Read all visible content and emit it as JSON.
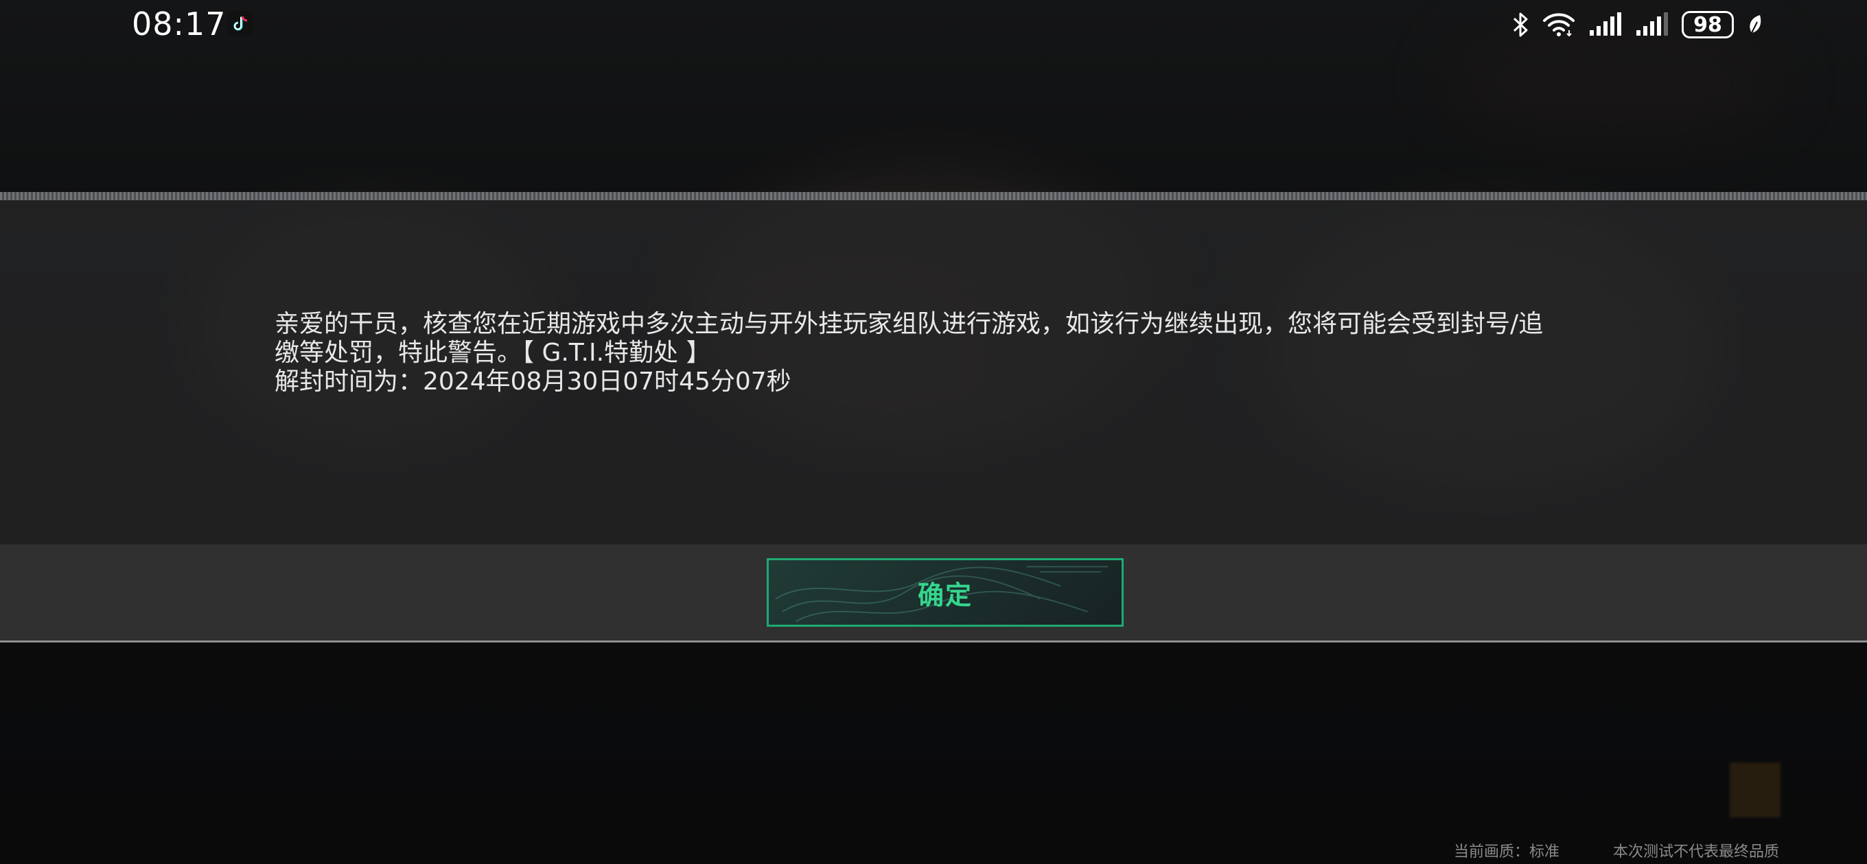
{
  "status_bar": {
    "time": "08:17",
    "battery_level": "98",
    "icons": [
      "tiktok-icon",
      "bluetooth-icon",
      "wifi-icon",
      "signal-icon",
      "signal-icon",
      "battery-icon",
      "leaf-icon"
    ]
  },
  "dialog": {
    "message": "亲爱的干员，核查您在近期游戏中多次主动与开外挂玩家组队进行游戏，如该行为继续出现，您将可能会受到封号/追\n缴等处罚，特此警告。【 G.T.I.特勤处 】\n解封时间为：2024年08月30日07时45分07秒",
    "confirm_label": "确定"
  },
  "footer": {
    "quality": "当前画质：标准",
    "disclaimer": "本次测试不代表最终品质"
  },
  "colors": {
    "accent": "#35d68d",
    "button_border": "#1faa71",
    "text": "#e8e8e8",
    "panel": "#28282a"
  }
}
